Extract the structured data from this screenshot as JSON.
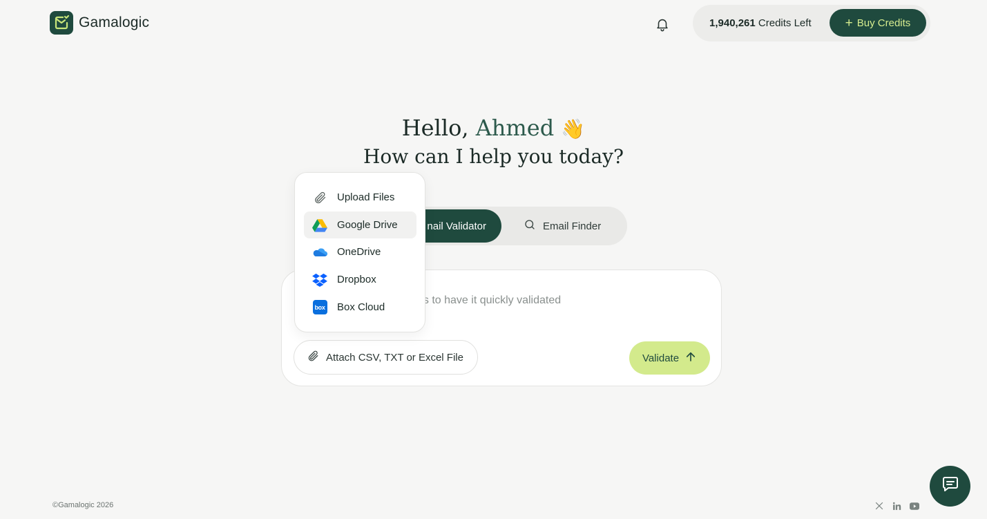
{
  "header": {
    "brand": "Gamalogic",
    "credits_number": "1,940,261",
    "credits_suffix": "Credits Left",
    "buy_label": "Buy Credits"
  },
  "greeting": {
    "hello": "Hello,",
    "name": "Ahmed",
    "wave": "👋",
    "question": "How can I help you today?"
  },
  "tabs": {
    "validator_label": "nail Validator",
    "finder_label": "Email Finder"
  },
  "input": {
    "placeholder_visible": "ess to have it quickly validated",
    "attach_label": "Attach CSV, TXT or Excel File",
    "validate_label": "Validate"
  },
  "dropdown": {
    "items": [
      {
        "label": "Upload Files",
        "icon": "paperclip-icon"
      },
      {
        "label": "Google Drive",
        "icon": "google-drive-icon"
      },
      {
        "label": "OneDrive",
        "icon": "onedrive-icon"
      },
      {
        "label": "Dropbox",
        "icon": "dropbox-icon"
      },
      {
        "label": "Box Cloud",
        "icon": "box-icon"
      }
    ],
    "box_icon_text": "box"
  },
  "footer": {
    "copyright": "©Gamalogic 2026"
  },
  "colors": {
    "brand_dark": "#1f4a3e",
    "accent_lime": "#d3ea8c",
    "background": "#f6f6f5"
  }
}
